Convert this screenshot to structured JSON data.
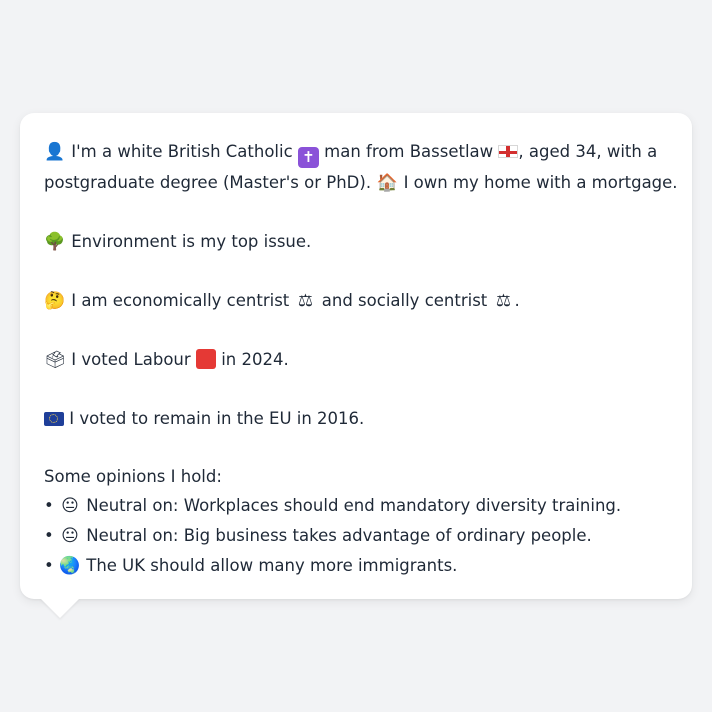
{
  "profile": {
    "intro": {
      "icon": "person-silhouette-icon",
      "part1": "I'm a white British Catholic",
      "religion_icon": "latin-cross-icon",
      "part2": "man from Bassetlaw",
      "flag_icon": "england-flag-icon",
      "part3": ", aged 34, with a",
      "line2_part1": "postgraduate degree (Master's or PhD).",
      "home_icon": "house-icon",
      "line2_part2": "I own my home with a mortgage."
    },
    "issue": {
      "icon": "tree-icon",
      "text": "Environment is my top issue."
    },
    "ideology": {
      "icon": "thinking-face-icon",
      "part1": "I am economically centrist",
      "scale_icon": "balance-scale-icon",
      "part2": "and socially centrist",
      "part3": "."
    },
    "vote": {
      "icon": "ballot-box-icon",
      "part1": "I voted Labour",
      "party_color_icon": "red-square-icon",
      "party_color": "#e53935",
      "part2": "in 2024."
    },
    "brexit": {
      "icon": "eu-flag-icon",
      "text": "I voted to remain in the EU in 2016."
    },
    "opinions_header": "Some opinions I hold:",
    "opinions": [
      {
        "bullet": "•",
        "icon": "neutral-face-icon",
        "text": "Neutral on: Workplaces should end mandatory diversity training."
      },
      {
        "bullet": "•",
        "icon": "neutral-face-icon",
        "text": "Neutral on: Big business takes advantage of ordinary people."
      },
      {
        "bullet": "•",
        "icon": "globe-icon",
        "text": "The UK should allow many more immigrants."
      }
    ]
  },
  "colors": {
    "background": "#f2f3f5",
    "bubble": "#ffffff",
    "text": "#1f2937"
  }
}
